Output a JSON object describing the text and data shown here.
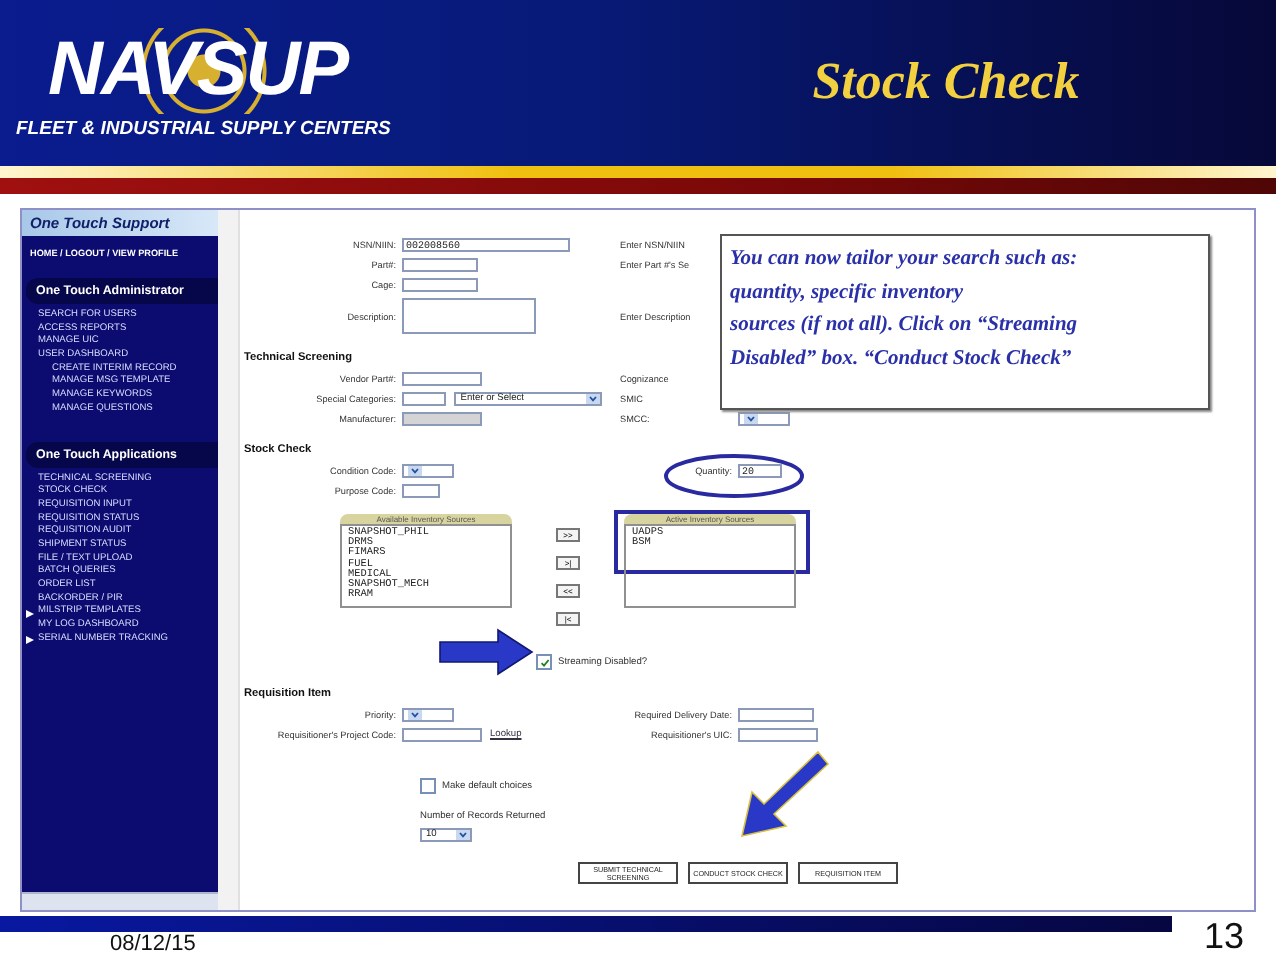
{
  "header": {
    "logo": "NAVSUP",
    "tagline": "FLEET & INDUSTRIAL SUPPLY CENTERS",
    "title": "Stock Check"
  },
  "sidebar": {
    "brand": "One Touch Support",
    "top_link": "HOME / LOGOUT / VIEW PROFILE",
    "sections": [
      {
        "title": "One Touch Administrator",
        "items": [
          {
            "label": "SEARCH FOR USERS",
            "expandable": false
          },
          {
            "label": "ACCESS REPORTS",
            "expandable": false
          },
          {
            "label": "MANAGE UIC",
            "expandable": false
          },
          {
            "label": "USER DASHBOARD",
            "expandable": false,
            "children": [
              {
                "label": "CREATE INTERIM RECORD",
                "expandable": false
              },
              {
                "label": "MANAGE MSG TEMPLATE",
                "expandable": false
              },
              {
                "label": "MANAGE KEYWORDS",
                "expandable": false
              },
              {
                "label": "MANAGE QUESTIONS",
                "expandable": false
              }
            ]
          }
        ]
      },
      {
        "title": "One Touch Applications",
        "items": [
          {
            "label": "TECHNICAL SCREENING",
            "expandable": false
          },
          {
            "label": "STOCK CHECK",
            "expandable": false
          },
          {
            "label": "REQUISITION INPUT",
            "expandable": false
          },
          {
            "label": "REQUISITION STATUS",
            "expandable": false
          },
          {
            "label": "REQUISITION AUDIT",
            "expandable": false
          },
          {
            "label": "SHIPMENT STATUS",
            "expandable": false
          },
          {
            "label": "FILE / TEXT UPLOAD",
            "expandable": false
          },
          {
            "label": "BATCH QUERIES",
            "expandable": false
          },
          {
            "label": "ORDER LIST",
            "expandable": false
          },
          {
            "label": "BACKORDER / PIR",
            "expandable": false
          },
          {
            "label": "MILSTRIP TEMPLATES",
            "expandable": true
          },
          {
            "label": "MY LOG DASHBOARD",
            "expandable": false
          },
          {
            "label": "SERIAL NUMBER TRACKING",
            "expandable": true
          }
        ]
      }
    ]
  },
  "search": {
    "rows": [
      {
        "left": {
          "label": "NSN/NIIN:",
          "kind": "text",
          "value": "002008560"
        },
        "right": {
          "label": "Enter NSN/NIIN"
        }
      },
      {
        "left": {
          "label": "Part#:",
          "kind": "text"
        },
        "right": {
          "label": "Enter Part #'s Se"
        }
      },
      {
        "left": {
          "label": "Cage:",
          "kind": "text"
        }
      },
      {
        "left": {
          "label": "Description:",
          "kind": "textarea"
        },
        "right": {
          "label": "Enter Description"
        }
      }
    ]
  },
  "technical": {
    "title": "Technical Screening",
    "rows": [
      {
        "left": {
          "label": "Vendor Part#:",
          "kind": "short"
        },
        "right": {
          "label": "Cognizance"
        }
      },
      {
        "left": {
          "label": "Special Categories:",
          "kind": "combo",
          "value": "Enter or Select"
        },
        "right": {
          "label": "SMIC"
        }
      },
      {
        "left": {
          "label": "Manufacturer:",
          "kind": "disabled"
        },
        "right": {
          "label": "SMCC:",
          "kind": "select"
        }
      }
    ]
  },
  "stock_check": {
    "title": "Stock Check",
    "rows": [
      {
        "left": {
          "label": "Condition Code:",
          "kind": "select"
        },
        "right": {
          "label": "Quantity:",
          "kind": "number",
          "value": "20"
        }
      },
      {
        "left": {
          "label": "Purpose Code:",
          "kind": "tiny"
        }
      }
    ],
    "available": {
      "title": "Available Inventory Sources",
      "items": [
        "SNAPSHOT_PHIL",
        "DRMS",
        "FIMARS",
        "FUEL",
        "MEDICAL",
        "SNAPSHOT_MECH",
        "RRAM"
      ]
    },
    "moves": [
      ">>",
      ">|",
      "<<",
      "|<"
    ],
    "active": {
      "title": "Active Inventory Sources",
      "items": [
        "UADPS",
        "BSM"
      ]
    },
    "streaming": {
      "label": "Streaming Disabled?",
      "checked": true
    }
  },
  "requisition": {
    "title": "Requisition Item",
    "rows": [
      {
        "left": {
          "label": "Priority:",
          "kind": "select"
        },
        "right": {
          "label": "Required Delivery Date:",
          "kind": "text"
        }
      },
      {
        "left": {
          "label": "Requisitioner's Project Code:",
          "kind": "short",
          "link": "Lookup"
        },
        "right": {
          "label": "Requisitioner's UIC:",
          "kind": "short"
        }
      }
    ]
  },
  "options": {
    "make_default": {
      "label": "Make default choices",
      "checked": false
    },
    "records": {
      "label": "Number of Records Returned",
      "value": "10"
    }
  },
  "actions": [
    "SUBMIT TECHNICAL SCREENING",
    "CONDUCT STOCK CHECK",
    "REQUISITION ITEM"
  ],
  "callout": "You can now tailor your search such as:\nquantity,  specific inventory\n sources (if not all).  Click on “Streaming\nDisabled” box.  “Conduct Stock Check”",
  "footer": {
    "date": "08/12/15",
    "page": "13"
  }
}
